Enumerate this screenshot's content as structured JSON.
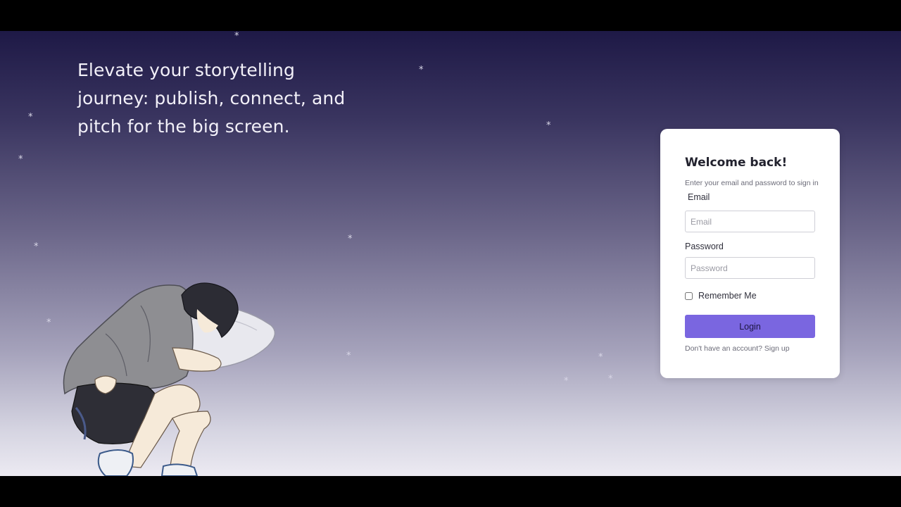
{
  "hero": {
    "tagline": "Elevate your storytelling journey: publish, connect, and pitch for the big screen."
  },
  "decor": {
    "star_glyph": "*",
    "illustration_icon": "sleeping-character-illustration"
  },
  "login": {
    "title": "Welcome back!",
    "subtitle": "Enter your email and password to sign in",
    "email_label": "Email",
    "email_placeholder": "Email",
    "email_value": "",
    "password_label": "Password",
    "password_placeholder": "Password",
    "password_value": "",
    "remember_label": "Remember Me",
    "remember_checked": false,
    "button_label": "Login",
    "signup_prompt": "Don't have an account?",
    "signup_link": "Sign up"
  },
  "colors": {
    "accent": "#7a66e0",
    "background_top": "#1e1946",
    "background_bottom": "#eceaf2"
  }
}
